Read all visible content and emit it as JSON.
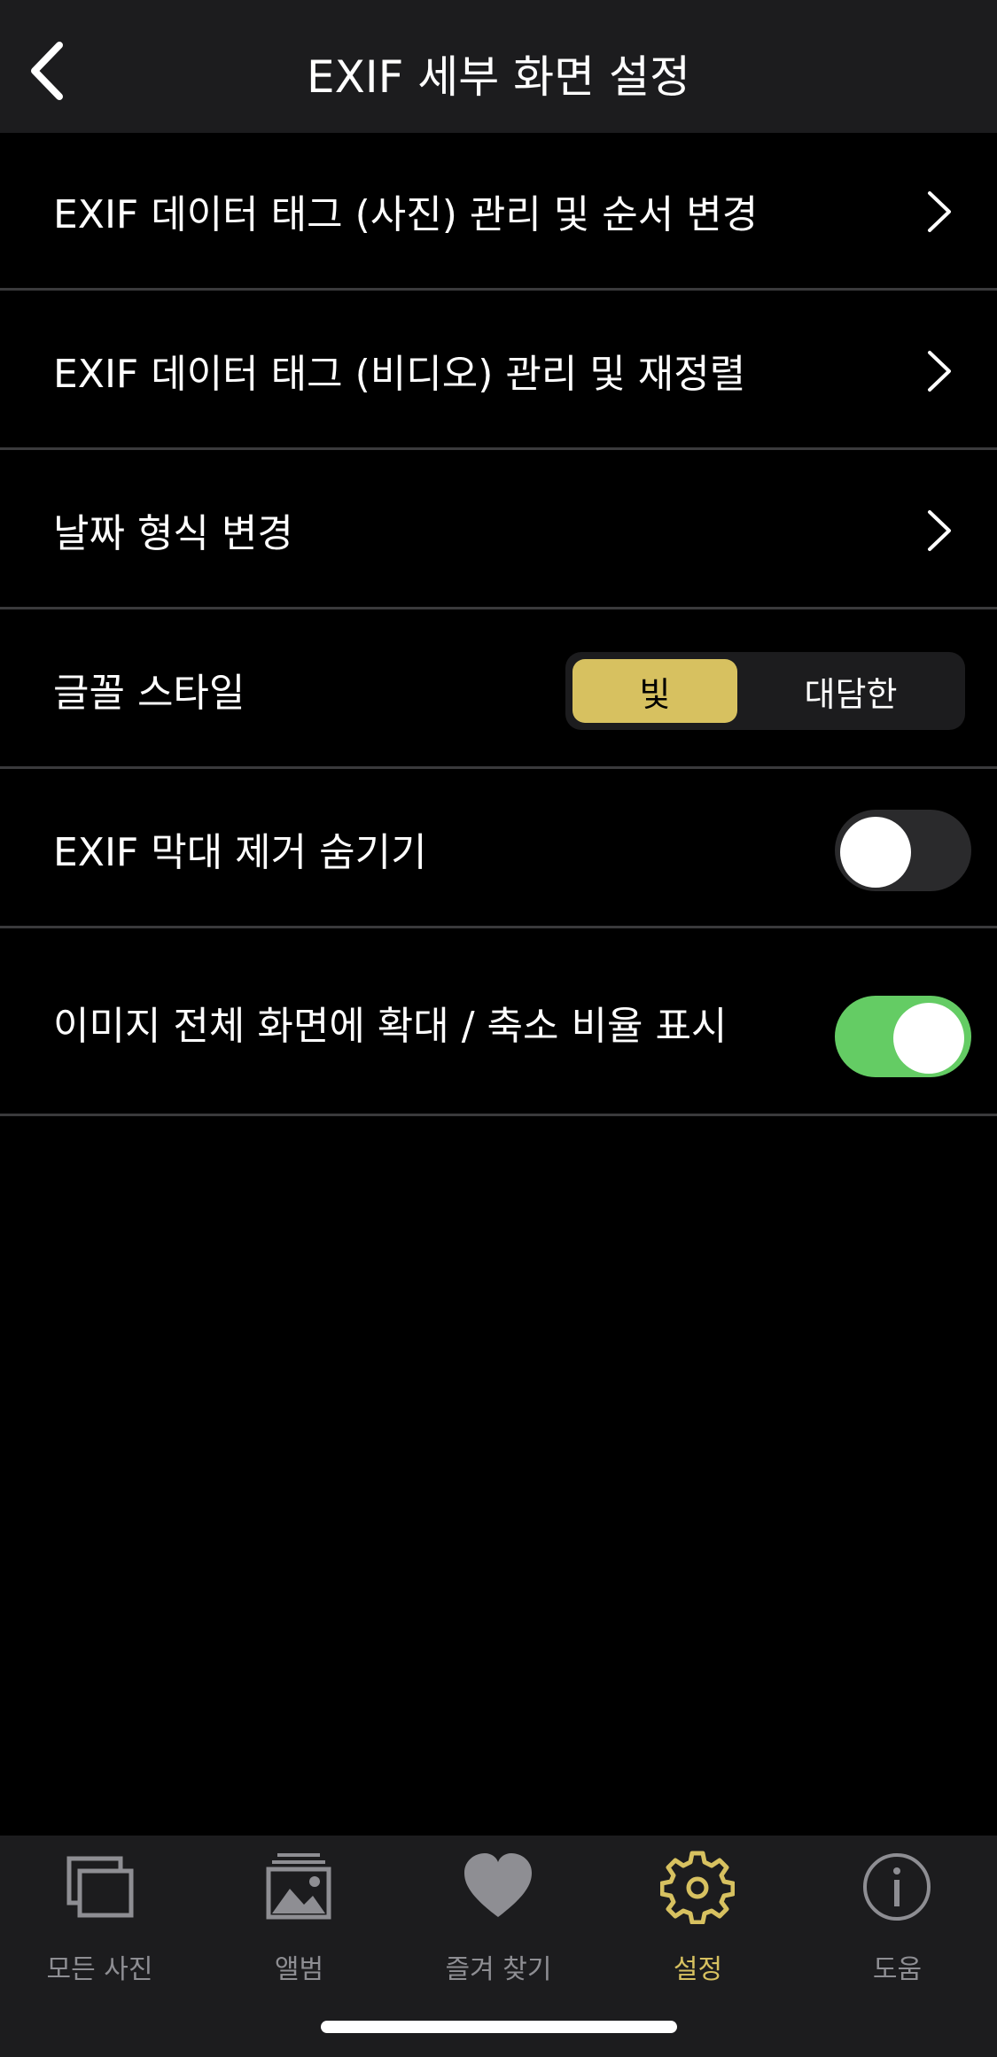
{
  "header": {
    "title": "EXIF 세부 화면 설정",
    "back_icon": "chevron-left-icon"
  },
  "rows": [
    {
      "label": "EXIF 데이터 태그 (사진) 관리 및 순서 변경",
      "accessory": "chevron-right-icon"
    },
    {
      "label": "EXIF 데이터 태그 (비디오) 관리 및 재정렬",
      "accessory": "chevron-right-icon"
    },
    {
      "label": "날짜 형식 변경",
      "accessory": "chevron-right-icon"
    },
    {
      "label": "글꼴 스타일",
      "options": [
        "빛",
        "대담한"
      ],
      "selected": "빛"
    },
    {
      "label": "EXIF 막대 제거 숨기기",
      "toggle": false
    },
    {
      "label": "이미지 전체 화면에 확대 / 축소 비율 표시",
      "toggle": true
    }
  ],
  "tabbar": {
    "items": [
      {
        "label": "모든 사진",
        "icon": "photos-stack-icon",
        "active": false
      },
      {
        "label": "앨범",
        "icon": "album-icon",
        "active": false
      },
      {
        "label": "즐겨 찾기",
        "icon": "heart-icon",
        "active": false
      },
      {
        "label": "설정",
        "icon": "gear-icon",
        "active": true
      },
      {
        "label": "도움",
        "icon": "info-icon",
        "active": false
      }
    ]
  },
  "colors": {
    "background": "#000000",
    "bar_background": "#1c1c1e",
    "accent": "#d7c160",
    "toggle_on": "#64cc64",
    "inactive_tab": "#8e8e93",
    "separator": "#3a3a3c"
  }
}
